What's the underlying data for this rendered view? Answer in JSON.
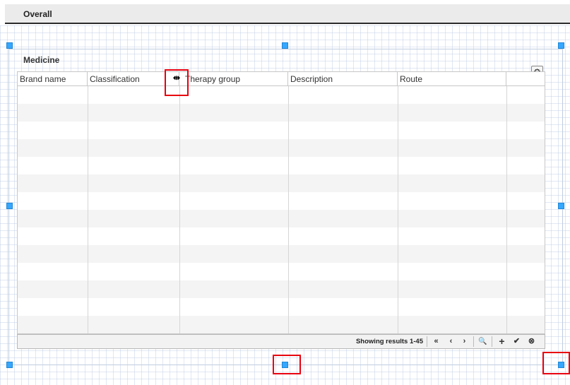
{
  "tab": {
    "title": "Overall"
  },
  "panel": {
    "title": "Medicine"
  },
  "grid": {
    "columns": [
      "Brand name",
      "Classification",
      "Therapy group",
      "Description",
      "Route"
    ],
    "header_cursor_overlay": "⇹",
    "row_count": 14
  },
  "footer": {
    "results": "Showing results 1-45",
    "first_icon": "«",
    "prev_icon": "‹",
    "next_icon": "›",
    "search_icon": "🔍",
    "add_icon": "+",
    "save_icon": "✔",
    "cancel_icon": "⊗"
  },
  "icons": {
    "gear": "⚙"
  },
  "colors": {
    "handle": "#35a7ff",
    "highlight": "#e8000f"
  }
}
